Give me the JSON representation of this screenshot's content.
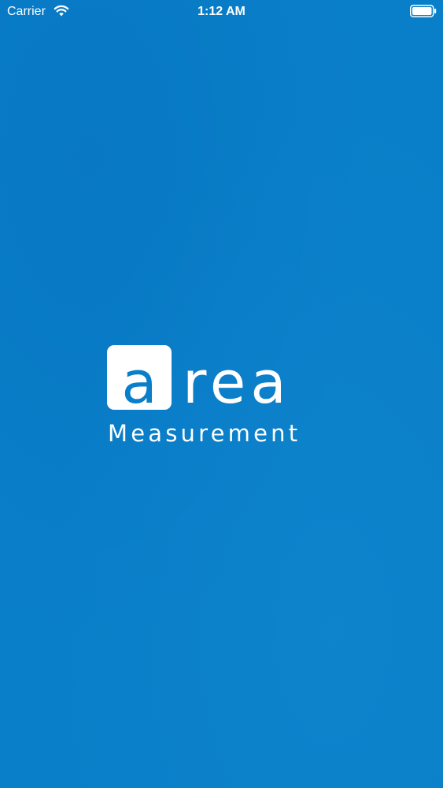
{
  "status_bar": {
    "carrier": "Carrier",
    "time": "1:12 AM",
    "icons": [
      "wifi-icon",
      "battery-icon"
    ]
  },
  "splash": {
    "logo_letter": "a",
    "logo_text": "rea",
    "subtitle": "Measurement"
  },
  "colors": {
    "background": "#0a7fc9",
    "foreground": "#ffffff"
  }
}
